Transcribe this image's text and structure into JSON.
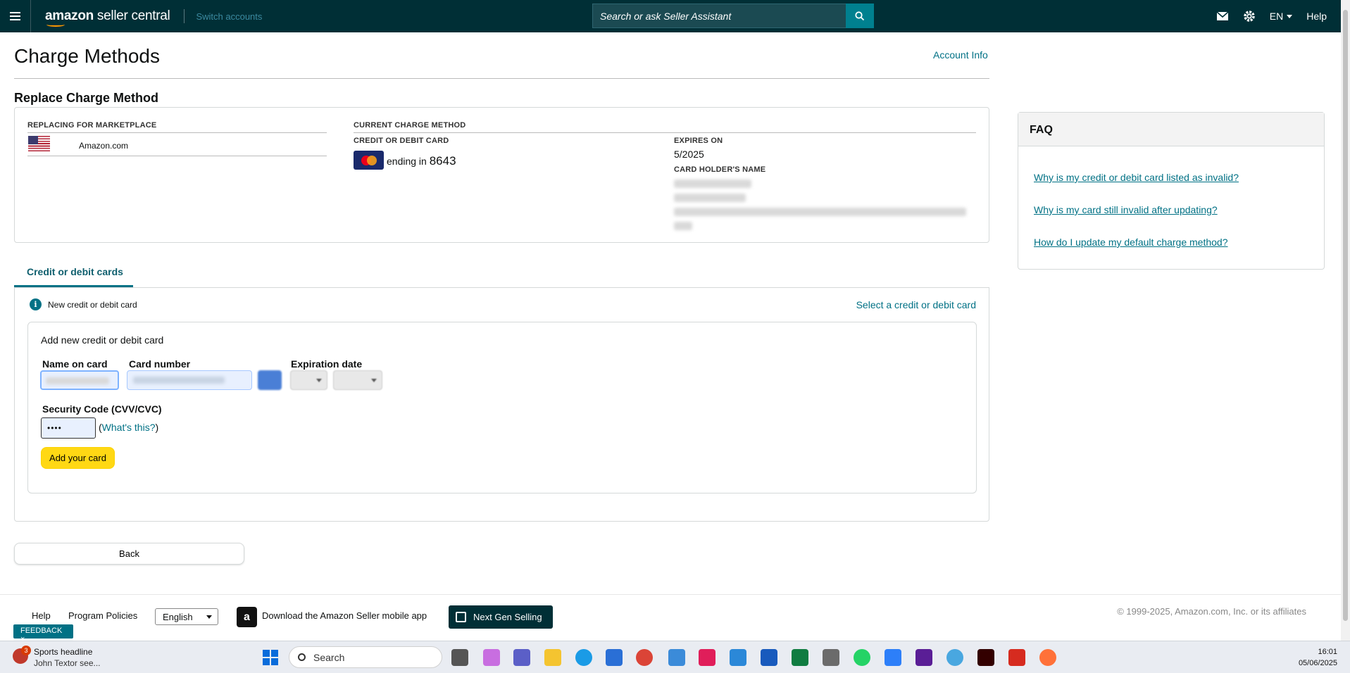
{
  "nav": {
    "logo_bold": "amazon",
    "logo_rest": " seller central",
    "switch_accounts": "Switch accounts",
    "search_placeholder": "Search or ask Seller Assistant",
    "language": "EN",
    "help": "Help",
    "icons": [
      "menu-icon",
      "search-icon",
      "mail-icon",
      "gear-icon"
    ]
  },
  "page": {
    "title": "Charge Methods",
    "account_info": "Account Info",
    "section_title": "Replace Charge Method"
  },
  "replace": {
    "marketplace_head": "REPLACING FOR MARKETPLACE",
    "marketplace_name": "Amazon.com",
    "current_head": "CURRENT CHARGE METHOD",
    "card_head": "CREDIT OR DEBIT CARD",
    "ending_text": "ending in",
    "card_last4": "8643",
    "expires_head": "EXPIRES ON",
    "expires_value": "5/2025",
    "holder_head": "CARD HOLDER'S NAME"
  },
  "tabs": {
    "active": "Credit or debit cards"
  },
  "cards": {
    "new_card_label": "New credit or debit card",
    "select_link": "Select a credit or debit card",
    "add_title": "Add new credit or debit card",
    "name_label": "Name on card",
    "number_label": "Card number",
    "expiry_label": "Expiration date",
    "cvv_label": "Security Code (CVV/CVC)",
    "cvv_value": "••••",
    "whats_this": "What's this?",
    "add_button": "Add your card"
  },
  "back_button": "Back",
  "faq": {
    "title": "FAQ",
    "links": [
      "Why is my credit or debit card listed as invalid?",
      "Why is my card still invalid after updating?",
      "How do I update my default charge method?"
    ]
  },
  "footer": {
    "help": "Help",
    "program_policies": "Program Policies",
    "language_select": "English",
    "app_text": "Download the Amazon Seller mobile app",
    "next_gen": "Next Gen Selling",
    "copyright": "© 1999-2025, Amazon.com, Inc. or its affiliates",
    "feedback": "FEEDBACK"
  },
  "taskbar": {
    "news_badge": "3",
    "news_title": "Sports headline",
    "news_sub": "John Textor see...",
    "search": "Search",
    "time": "16:01",
    "date": "05/06/2025"
  },
  "colors": {
    "nav_bg": "#002f36",
    "link": "#007185",
    "add_button": "#ffd814"
  }
}
